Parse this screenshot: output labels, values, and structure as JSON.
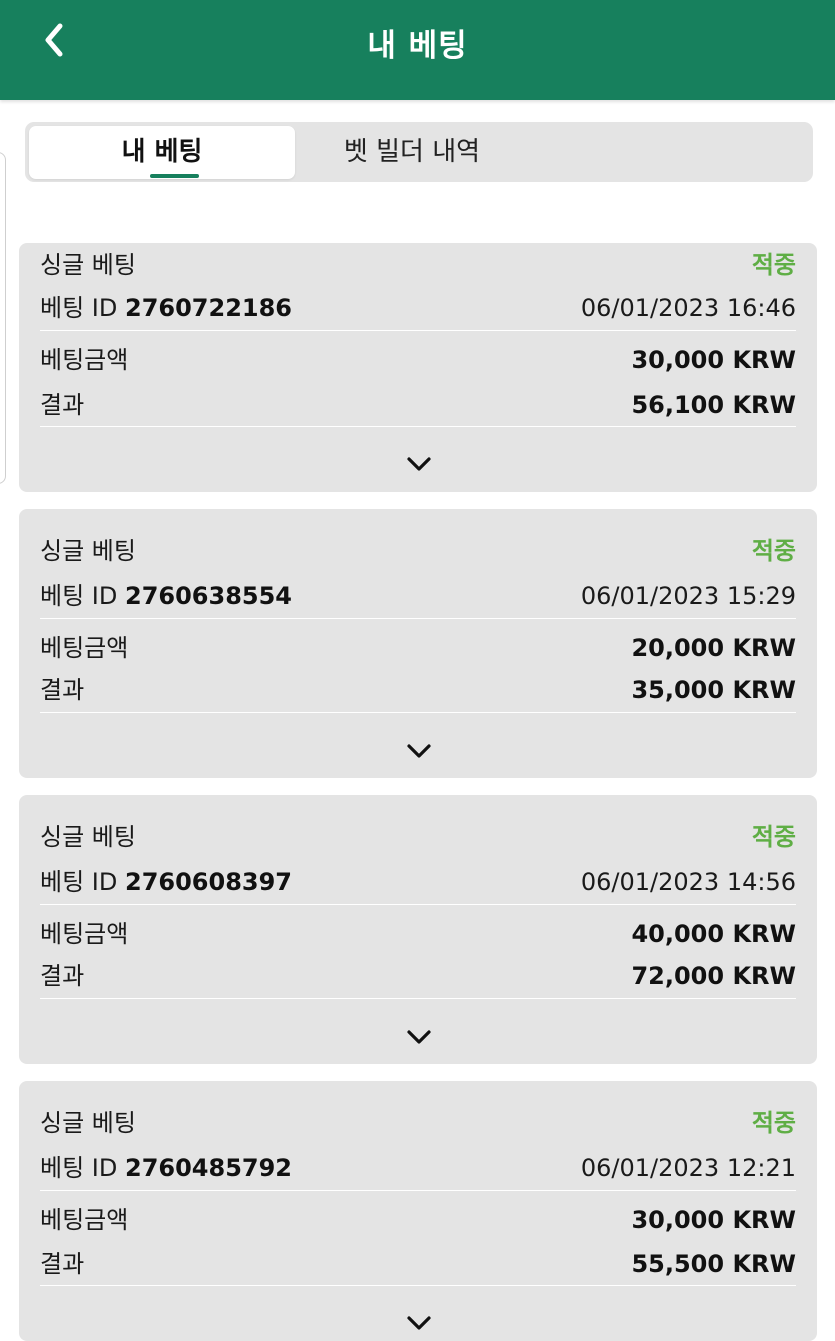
{
  "header": {
    "title": "내 베팅",
    "back_icon": "chevron-left-icon"
  },
  "tabs": [
    {
      "label": "내 베팅",
      "active": true
    },
    {
      "label": "벳 빌더 내역",
      "active": false
    }
  ],
  "colors": {
    "brand": "#17805d",
    "status_win": "#5fae45",
    "card_bg": "#e4e4e4"
  },
  "bets": [
    {
      "type": "싱글 베팅",
      "status": "적중",
      "id_label": "베팅 ID",
      "id": "2760722186",
      "datetime": "06/01/2023 16:46",
      "stake_label": "베팅금액",
      "stake": "30,000 KRW",
      "result_label": "결과",
      "result": "56,100 KRW"
    },
    {
      "type": "싱글 베팅",
      "status": "적중",
      "id_label": "베팅 ID",
      "id": "2760638554",
      "datetime": "06/01/2023 15:29",
      "stake_label": "베팅금액",
      "stake": "20,000 KRW",
      "result_label": "결과",
      "result": "35,000 KRW"
    },
    {
      "type": "싱글 베팅",
      "status": "적중",
      "id_label": "베팅 ID",
      "id": "2760608397",
      "datetime": "06/01/2023 14:56",
      "stake_label": "베팅금액",
      "stake": "40,000 KRW",
      "result_label": "결과",
      "result": "72,000 KRW"
    },
    {
      "type": "싱글 베팅",
      "status": "적중",
      "id_label": "베팅 ID",
      "id": "2760485792",
      "datetime": "06/01/2023 12:21",
      "stake_label": "베팅금액",
      "stake": "30,000 KRW",
      "result_label": "결과",
      "result": "55,500 KRW"
    }
  ]
}
